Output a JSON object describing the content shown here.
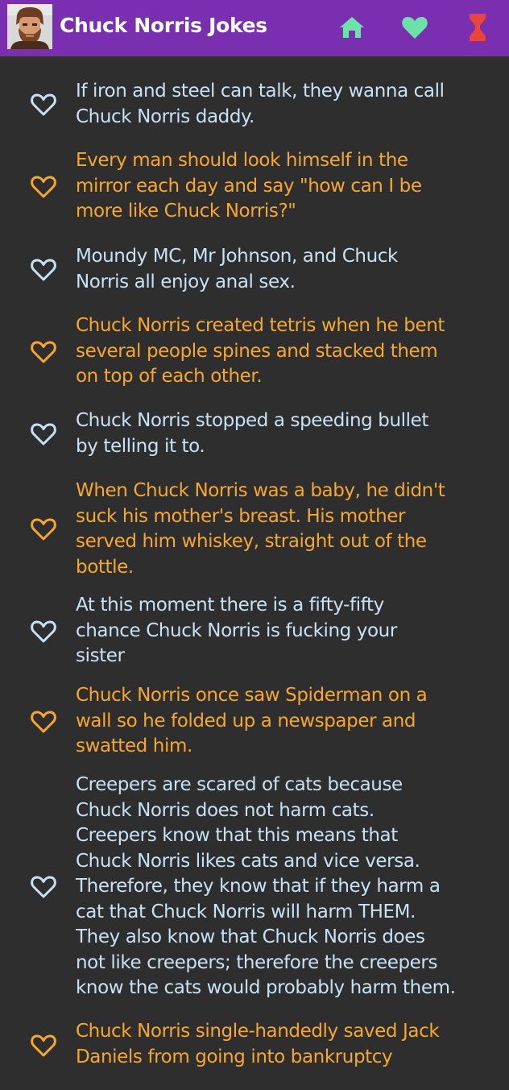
{
  "app": {
    "title": "Chuck Norris Jokes"
  },
  "nav": {
    "items": [
      {
        "icon": "home-icon",
        "color": "#6be2a8"
      },
      {
        "icon": "heart-filled-icon",
        "color": "#6be2a8"
      },
      {
        "icon": "hourglass-icon",
        "color": "#e8453c"
      }
    ]
  },
  "colors": {
    "appbar": "#7a2fb0",
    "background": "#2e2e2e",
    "joke_blue": "#c7e2f5",
    "joke_orange": "#f7a72e"
  },
  "jokes": [
    {
      "text": "If iron and steel can talk, they wanna call\nChuck Norris daddy.",
      "color": "blue"
    },
    {
      "text": "Every man should look himself in the\nmirror each day and say \"how can I be\nmore like Chuck Norris?\"",
      "color": "orange"
    },
    {
      "text": "Moundy MC, Mr Johnson, and Chuck\nNorris all enjoy anal sex.",
      "color": "blue"
    },
    {
      "text": "Chuck Norris created tetris when he bent\nseveral people spines and stacked them\non top of each other.",
      "color": "orange"
    },
    {
      "text": "Chuck Norris stopped a speeding bullet\nby telling it to.",
      "color": "blue"
    },
    {
      "text": "When Chuck Norris was a baby, he didn't\nsuck his mother's breast. His mother\nserved him whiskey, straight out of the\nbottle.",
      "color": "orange"
    },
    {
      "text": "At this moment there is a fifty-fifty\nchance Chuck Norris is fucking your\nsister",
      "color": "blue"
    },
    {
      "text": "Chuck Norris once saw Spiderman on a\nwall so he folded up a newspaper and\nswatted him.",
      "color": "orange"
    },
    {
      "text": "Creepers are scared of cats because\nChuck Norris does not harm cats.\nCreepers know that this means that\nChuck Norris likes cats and vice versa.\nTherefore, they know that if they harm a\ncat that Chuck Norris will harm THEM.\nThey also know that Chuck Norris does\nnot like creepers; therefore the creepers\nknow the cats would probably harm them.",
      "color": "blue"
    },
    {
      "text": "Chuck Norris single-handedly saved Jack\nDaniels from going into bankruptcy",
      "color": "orange"
    }
  ]
}
